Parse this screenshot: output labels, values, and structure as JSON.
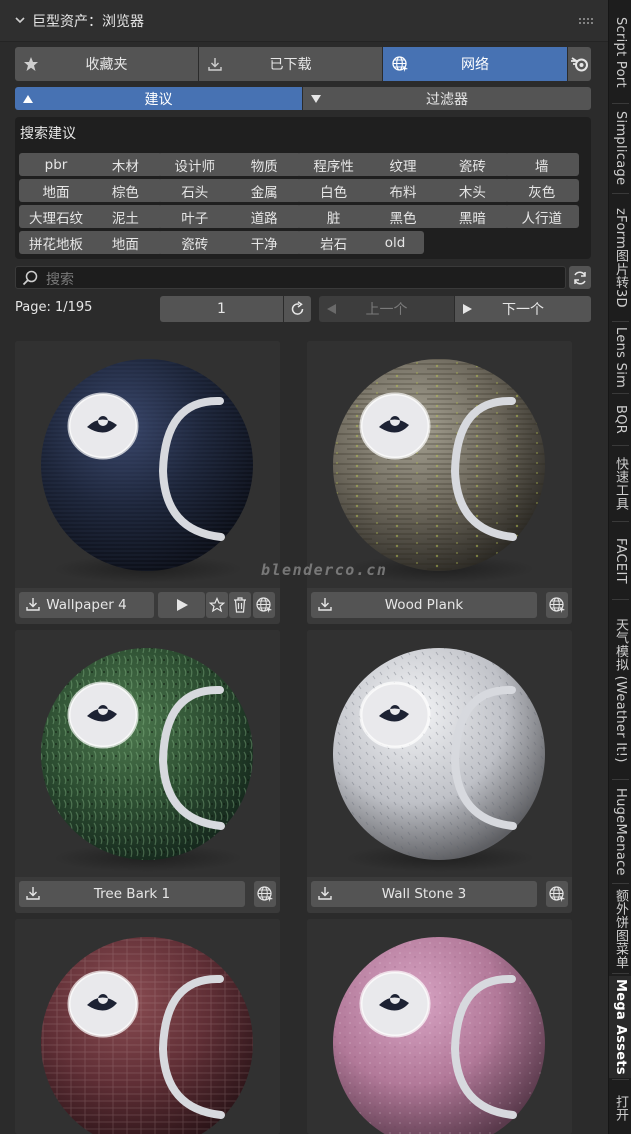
{
  "header": {
    "title": "巨型资产：浏览器"
  },
  "sources": [
    {
      "label": "收藏夹",
      "icon": "star-icon",
      "active": false
    },
    {
      "label": "已下载",
      "icon": "download-icon",
      "active": false
    },
    {
      "label": "网络",
      "icon": "globe-icon",
      "active": true
    }
  ],
  "modes": [
    {
      "label": "建议",
      "active": true
    },
    {
      "label": "过滤器",
      "active": false
    }
  ],
  "suggestions": {
    "title": "搜索建议",
    "tags": [
      "pbr",
      "木材",
      "设计师",
      "物质",
      "程序性",
      "纹理",
      "瓷砖",
      "墙",
      "地面",
      "棕色",
      "石头",
      "金属",
      "白色",
      "布料",
      "木头",
      "灰色",
      "大理石纹",
      "泥土",
      "叶子",
      "道路",
      "脏",
      "黑色",
      "黑暗",
      "人行道",
      "拼花地板",
      "地面",
      "瓷砖",
      "干净",
      "岩石",
      "old"
    ]
  },
  "search": {
    "placeholder": "搜索",
    "value": ""
  },
  "pagination": {
    "label": "Page: 1/195",
    "page_value": "1",
    "prev_label": "上一个",
    "next_label": "下一个"
  },
  "assets": [
    {
      "name": "Wallpaper 4",
      "material": "dark-blue-fabric",
      "selected": true
    },
    {
      "name": "Wood Plank",
      "material": "weathered-wood"
    },
    {
      "name": "Tree Bark 1",
      "material": "green-bark"
    },
    {
      "name": "Wall Stone 3",
      "material": "white-stone"
    },
    {
      "name": "",
      "material": "red-brick"
    },
    {
      "name": "",
      "material": "pink-plaster"
    }
  ],
  "watermark": "blenderco.cn",
  "sidebar_tabs": [
    {
      "label": "Script Port"
    },
    {
      "label": "Simplicage"
    },
    {
      "label": "zForm图片转3D"
    },
    {
      "label": "Lens Sim"
    },
    {
      "label": "BQR"
    },
    {
      "label": "快速工具"
    },
    {
      "label": "FACEIT"
    },
    {
      "label": "天气模拟 (Weather It!)"
    },
    {
      "label": "HugeMenace"
    },
    {
      "label": "额外饼图菜单"
    },
    {
      "label": "Mega Assets",
      "active": true
    },
    {
      "label": "打开"
    }
  ],
  "colors": {
    "accent": "#4772b3",
    "button": "#545454",
    "panel": "#2b2b2b",
    "field": "#1f1f1f"
  }
}
